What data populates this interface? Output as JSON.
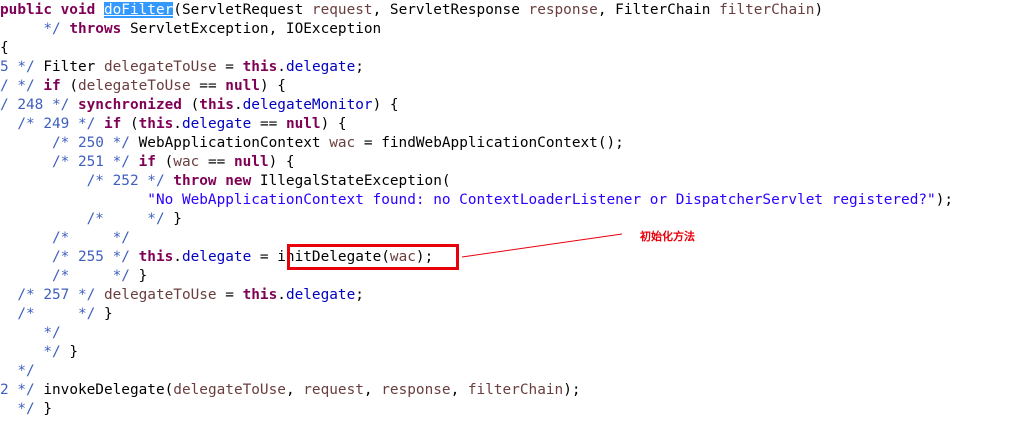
{
  "colors": {
    "keyword": "#7f0055",
    "comment": "#3f5fbf",
    "field": "#0000c0",
    "variable": "#6a3e3e",
    "string": "#2a00ff",
    "selection": "#3399ff",
    "annotation": "#e8000b"
  },
  "annotation": {
    "text": "初始化方法"
  },
  "code_lines": [
    [
      [
        "kw",
        "public void "
      ],
      [
        "hl",
        "doFilter"
      ],
      [
        "id",
        "("
      ],
      [
        "id",
        "ServletRequest "
      ],
      [
        "var",
        "request"
      ],
      [
        "id",
        ", "
      ],
      [
        "id",
        "ServletResponse "
      ],
      [
        "var",
        "response"
      ],
      [
        "id",
        ", "
      ],
      [
        "id",
        "FilterChain "
      ],
      [
        "var",
        "filterChain"
      ],
      [
        "id",
        ")"
      ]
    ],
    [
      [
        "cm",
        "     */ "
      ],
      [
        "kw",
        "throws "
      ],
      [
        "id",
        "ServletException, IOException"
      ]
    ],
    [
      [
        "id",
        "{"
      ]
    ],
    [
      [
        "cm",
        "5 */ "
      ],
      [
        "id",
        "Filter "
      ],
      [
        "var",
        "delegateToUse"
      ],
      [
        "id",
        " = "
      ],
      [
        "kw",
        "this"
      ],
      [
        "id",
        "."
      ],
      [
        "fld",
        "delegate"
      ],
      [
        "id",
        ";"
      ]
    ],
    [
      [
        "cm",
        "/ */ "
      ],
      [
        "kw",
        "if "
      ],
      [
        "id",
        "("
      ],
      [
        "var",
        "delegateToUse"
      ],
      [
        "id",
        " == "
      ],
      [
        "kw",
        "null"
      ],
      [
        "id",
        ") {"
      ]
    ],
    [
      [
        "cm",
        "/ 248 */ "
      ],
      [
        "kw",
        "synchronized "
      ],
      [
        "id",
        "("
      ],
      [
        "kw",
        "this"
      ],
      [
        "id",
        "."
      ],
      [
        "fld",
        "delegateMonitor"
      ],
      [
        "id",
        ") {"
      ]
    ],
    [
      [
        "cm",
        "  /* 249 */ "
      ],
      [
        "kw",
        "if "
      ],
      [
        "id",
        "("
      ],
      [
        "kw",
        "this"
      ],
      [
        "id",
        "."
      ],
      [
        "fld",
        "delegate"
      ],
      [
        "id",
        " == "
      ],
      [
        "kw",
        "null"
      ],
      [
        "id",
        ") {"
      ]
    ],
    [
      [
        "cm",
        "      /* 250 */ "
      ],
      [
        "id",
        "WebApplicationContext "
      ],
      [
        "var",
        "wac"
      ],
      [
        "id",
        " = findWebApplicationContext();"
      ]
    ],
    [
      [
        "cm",
        "      /* 251 */ "
      ],
      [
        "kw",
        "if "
      ],
      [
        "id",
        "("
      ],
      [
        "var",
        "wac"
      ],
      [
        "id",
        " == "
      ],
      [
        "kw",
        "null"
      ],
      [
        "id",
        ") {"
      ]
    ],
    [
      [
        "cm",
        "          /* 252 */ "
      ],
      [
        "kw",
        "throw new "
      ],
      [
        "id",
        "IllegalStateException("
      ]
    ],
    [
      [
        "str",
        "                 \"No WebApplicationContext found: no ContextLoaderListener or DispatcherServlet registered?\""
      ],
      [
        "id",
        ");"
      ]
    ],
    [
      [
        "cm",
        "          /*     */ "
      ],
      [
        "id",
        "}"
      ]
    ],
    [
      [
        "cm",
        "      /*     */"
      ]
    ],
    [
      [
        "cm",
        "      /* 255 */ "
      ],
      [
        "kw",
        "this"
      ],
      [
        "id",
        "."
      ],
      [
        "fld",
        "delegate"
      ],
      [
        "id",
        " = "
      ],
      [
        "id",
        "initDelegate("
      ],
      [
        "var",
        "wac"
      ],
      [
        "id",
        ");"
      ]
    ],
    [
      [
        "cm",
        "      /*     */ "
      ],
      [
        "id",
        "}"
      ]
    ],
    [
      [
        "cm",
        "  /* 257 */ "
      ],
      [
        "var",
        "delegateToUse"
      ],
      [
        "id",
        " = "
      ],
      [
        "kw",
        "this"
      ],
      [
        "id",
        "."
      ],
      [
        "fld",
        "delegate"
      ],
      [
        "id",
        ";"
      ]
    ],
    [
      [
        "cm",
        "  /*     */ "
      ],
      [
        "id",
        "}"
      ]
    ],
    [
      [
        "cm",
        "     */"
      ]
    ],
    [
      [
        "cm",
        "     */ "
      ],
      [
        "id",
        "}"
      ]
    ],
    [
      [
        "cm",
        "  */"
      ]
    ],
    [
      [
        "cm",
        "2 */ "
      ],
      [
        "id",
        "invokeDelegate("
      ],
      [
        "var",
        "delegateToUse"
      ],
      [
        "id",
        ", "
      ],
      [
        "var",
        "request"
      ],
      [
        "id",
        ", "
      ],
      [
        "var",
        "response"
      ],
      [
        "id",
        ", "
      ],
      [
        "var",
        "filterChain"
      ],
      [
        "id",
        ");"
      ]
    ],
    [
      [
        "cm",
        "  */ "
      ],
      [
        "id",
        "}"
      ]
    ]
  ]
}
